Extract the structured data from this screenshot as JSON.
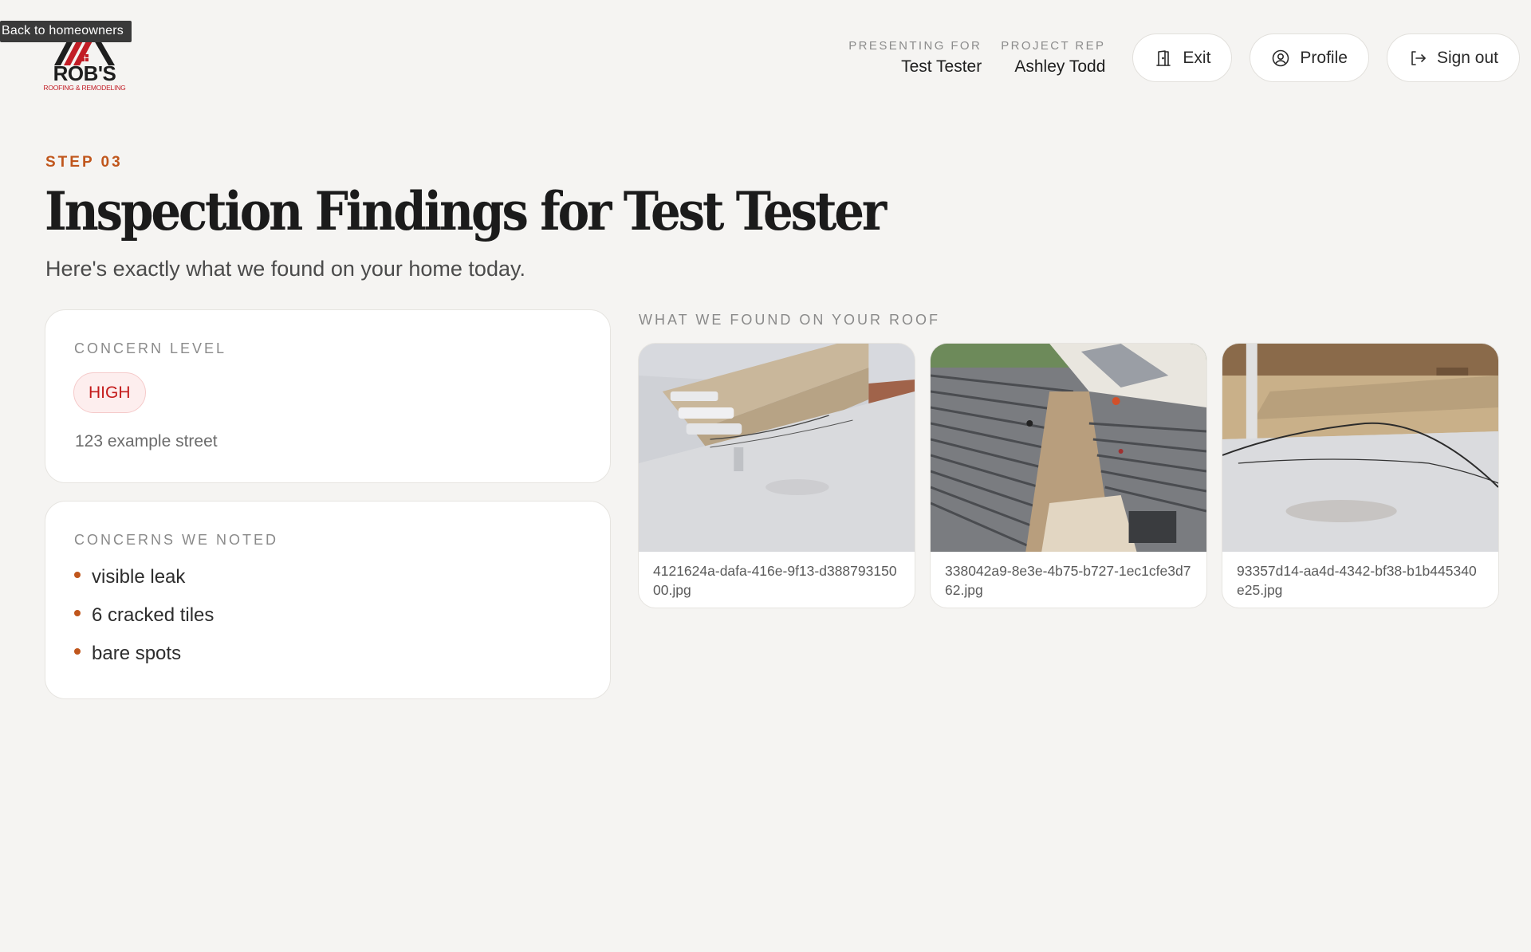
{
  "tooltip": "Back to homeowners",
  "logo": {
    "name": "ROB'S",
    "subtitle": "ROOFING & REMODELING",
    "brand_color": "#c21d26"
  },
  "header": {
    "presenting_label": "PRESENTING FOR",
    "presenting_value": "Test Tester",
    "rep_label": "PROJECT REP",
    "rep_value": "Ashley Todd",
    "exit_label": "Exit",
    "profile_label": "Profile",
    "signout_label": "Sign out"
  },
  "page": {
    "step": "STEP 03",
    "title": "Inspection Findings for Test Tester",
    "subtitle": "Here's exactly what we found on your home today."
  },
  "concern_card": {
    "label": "CONCERN LEVEL",
    "level": "HIGH",
    "address": "123 example street"
  },
  "noted_card": {
    "label": "CONCERNS WE NOTED",
    "items": [
      "visible leak",
      "6 cracked tiles",
      "bare spots"
    ]
  },
  "photos": {
    "label": "WHAT WE FOUND ON YOUR ROOF",
    "items": [
      {
        "caption": "4121624a-dafa-416e-9f13-d38879315000.jpg"
      },
      {
        "caption": "338042a9-8e3e-4b75-b727-1ec1cfe3d762.jpg"
      },
      {
        "caption": "93357d14-aa4d-4342-bf38-b1b445340e25.jpg"
      }
    ]
  },
  "colors": {
    "accent": "#c0561c",
    "high": "#c41b1b",
    "background": "#f5f4f2"
  }
}
